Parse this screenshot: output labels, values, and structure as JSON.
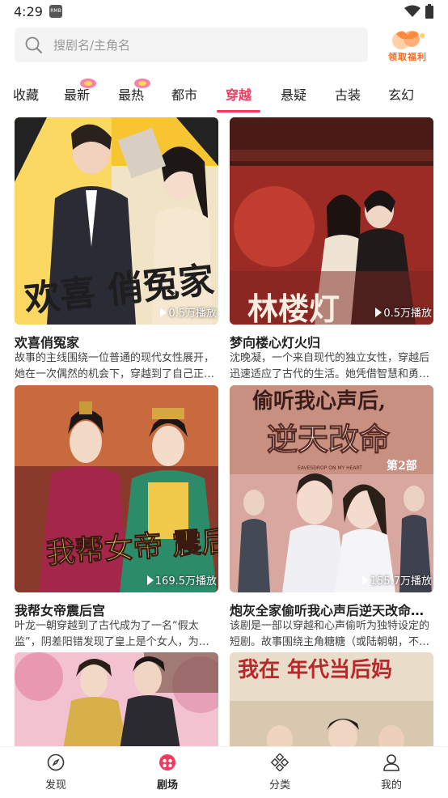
{
  "status_bar": {
    "time": "4:29",
    "notif_icon": "sim-card-icon"
  },
  "search": {
    "placeholder": "搜剧名/主角名"
  },
  "promo": {
    "label": "领取福利"
  },
  "tabs": [
    {
      "label": "收藏",
      "badge": false
    },
    {
      "label": "最新",
      "badge": true
    },
    {
      "label": "最热",
      "badge": true
    },
    {
      "label": "都市",
      "badge": false
    },
    {
      "label": "穿越",
      "badge": false,
      "active": true
    },
    {
      "label": "悬疑",
      "badge": false
    },
    {
      "label": "古装",
      "badge": false
    },
    {
      "label": "玄幻",
      "badge": false
    }
  ],
  "cards": [
    {
      "title": "欢喜俏冤家",
      "desc": "故事的主线围绕一位普通的现代女性展开，她在一次偶然的机会下，穿越到了自己正…",
      "plays": "0.5万播放",
      "poster_text": "欢喜 俏冤家"
    },
    {
      "title": "梦向楼心灯火归",
      "desc": "沈晚凝，一个来自现代的独立女性，穿越后迅速适应了古代的生活。她凭借智慧和勇…",
      "plays": "0.5万播放",
      "poster_text": "林楼灯"
    },
    {
      "title": "我帮女帝震后宫",
      "desc": "叶龙一朝穿越到了古代成为了一名“假太监”，阴差阳错发现了皇上是个女人，为了…",
      "plays": "169.5万播放",
      "poster_text": "我帮女帝 震后宫"
    },
    {
      "title": "炮灰全家偷听我心声后逆天改命…",
      "desc": "该剧是一部以穿越和心声偷听为独特设定的短剧。故事围绕主角糖糖（或陆朝朝，不…",
      "plays": "155.7万播放",
      "poster_text_1": "偷听我心声后,",
      "poster_text_2": "逆天改命",
      "poster_text_3": "第2部",
      "poster_sub": "EAVESDROP ON MY HEART"
    },
    {
      "title": "",
      "desc": "",
      "plays": "",
      "poster_text": ""
    },
    {
      "title": "",
      "desc": "",
      "plays": "",
      "poster_text": "我在 年代当后妈"
    }
  ],
  "nav": [
    {
      "label": "发现",
      "icon": "compass-icon"
    },
    {
      "label": "剧场",
      "icon": "theater-icon",
      "active": true
    },
    {
      "label": "分类",
      "icon": "category-icon"
    },
    {
      "label": "我的",
      "icon": "profile-icon"
    }
  ],
  "colors": {
    "accent": "#f23a5e",
    "promo": "#ff6a1a"
  }
}
